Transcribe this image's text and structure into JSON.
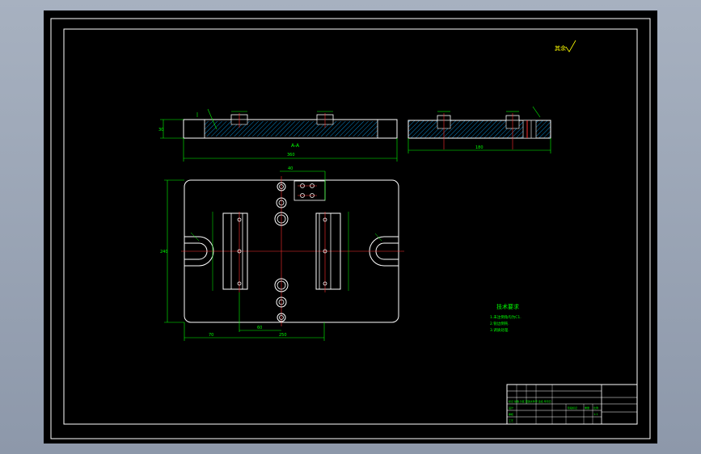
{
  "drawing": {
    "roughness_note": "其余",
    "section_label": "A-A",
    "tech_requirements": {
      "title": "技术要求",
      "lines": [
        "1.未注倒角均为C1.",
        "2.锐边倒钝.",
        "3.调质处理."
      ]
    },
    "dimensions": {
      "thickness": "30",
      "top_length": "360",
      "side_length": "180",
      "width": "240",
      "hole_offset": "60",
      "base_length": "250",
      "left_offset": "70",
      "hole_pitch": "40"
    },
    "title_block": {
      "row_labels": [
        "标记 处数 分区 更改文件号 签名 年月日",
        "设计",
        "审核",
        "工艺"
      ],
      "scale_labels": [
        "阶段标记",
        "重量",
        "比例"
      ],
      "scale_value": "1:1"
    }
  },
  "colors": {
    "background": "#000000",
    "frame": "#ffffff",
    "geometry": "#ffffff",
    "dimension": "#00ff00",
    "center_line": "#ff3030",
    "hatch": "#00aaff",
    "annotation": "#ffff00"
  }
}
